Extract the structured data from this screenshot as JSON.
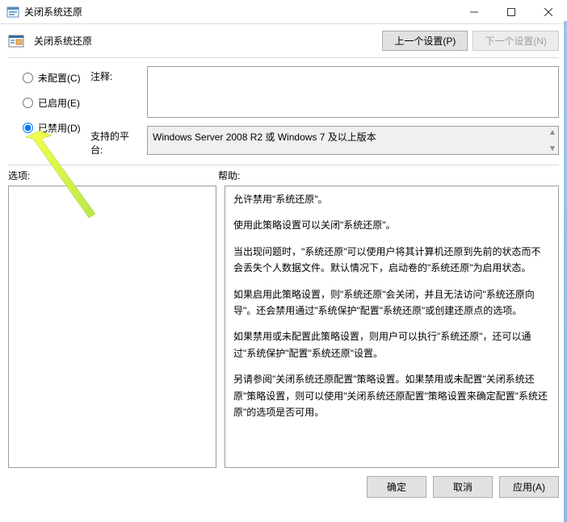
{
  "titlebar": {
    "title": "关闭系统还原"
  },
  "toolbar": {
    "subtitle": "关闭系统还原",
    "prev_button": "上一个设置(P)",
    "next_button": "下一个设置(N)"
  },
  "radios": {
    "not_configured": "未配置(C)",
    "enabled": "已启用(E)",
    "disabled": "已禁用(D)",
    "selected": "disabled"
  },
  "fields": {
    "comment_label": "注释:",
    "comment_value": "",
    "platform_label": "支持的平台:",
    "platform_value": "Windows Server 2008 R2 或 Windows 7 及以上版本"
  },
  "panels": {
    "options_label": "选项:",
    "help_label": "帮助:",
    "help_paragraphs": [
      "允许禁用\"系统还原\"。",
      "使用此策略设置可以关闭\"系统还原\"。",
      "当出现问题时，\"系统还原\"可以使用户将其计算机还原到先前的状态而不会丢失个人数据文件。默认情况下，启动卷的\"系统还原\"为启用状态。",
      "如果启用此策略设置，则\"系统还原\"会关闭，并且无法访问\"系统还原向导\"。还会禁用通过\"系统保护\"配置\"系统还原\"或创建还原点的选项。",
      "如果禁用或未配置此策略设置，则用户可以执行\"系统还原\"，还可以通过\"系统保护\"配置\"系统还原\"设置。",
      "另请参阅\"关闭系统还原配置\"策略设置。如果禁用或未配置\"关闭系统还原\"策略设置，则可以使用\"关闭系统还原配置\"策略设置来确定配置\"系统还原\"的选项是否可用。"
    ]
  },
  "buttons": {
    "ok": "确定",
    "cancel": "取消",
    "apply": "应用(A)"
  }
}
